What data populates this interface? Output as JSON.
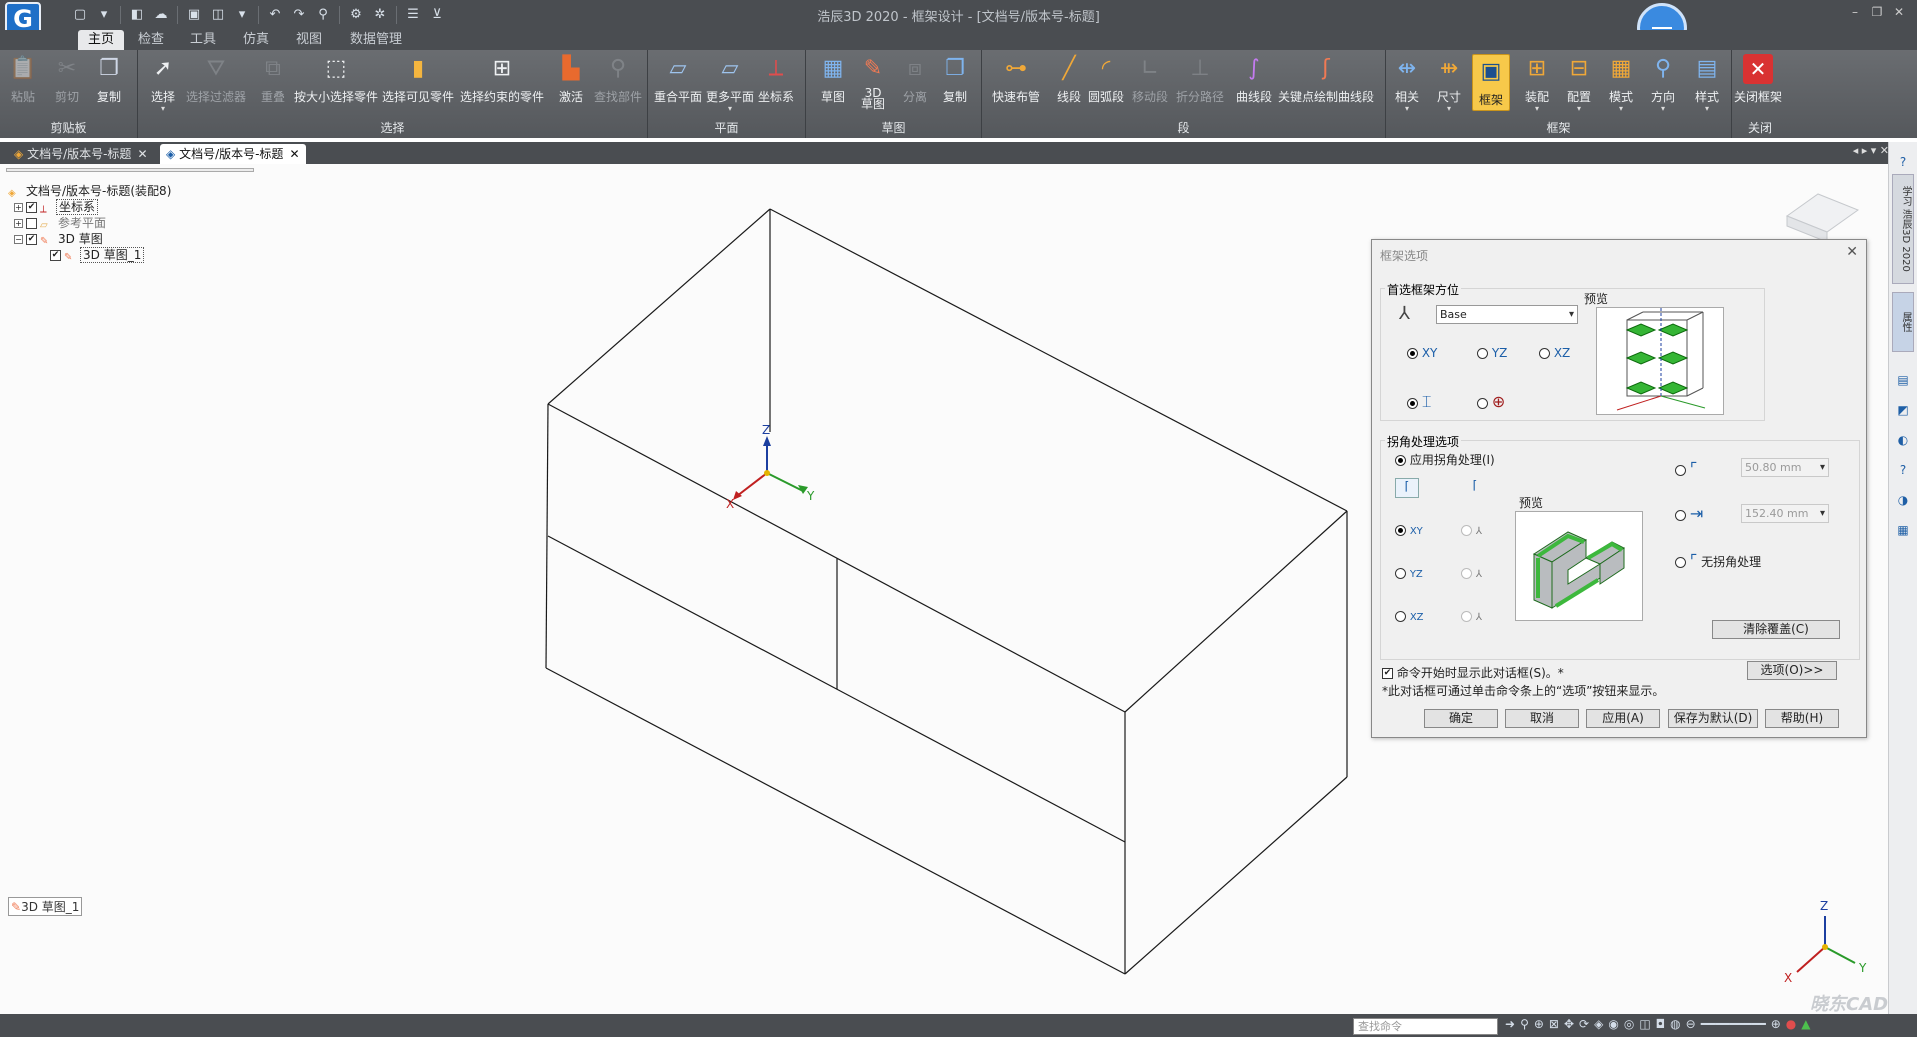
{
  "window": {
    "title": "浩辰3D 2020 - 框架设计 - [文档号/版本号-标题]"
  },
  "ribbon_tabs": [
    "主页",
    "检查",
    "工具",
    "仿真",
    "视图",
    "数据管理"
  ],
  "ribbon": {
    "clipboard": {
      "group": "剪贴板",
      "paste": "粘贴",
      "cut": "剪切",
      "copy": "复制"
    },
    "select": {
      "group": "选择",
      "select": "选择",
      "filter": "选择过滤器",
      "overlap": "重叠",
      "by_size": "按大小选择零件",
      "visible": "选择可见零件",
      "constrained": "选择约束的零件",
      "activate": "激活",
      "find": "查找部件"
    },
    "plane": {
      "group": "平面",
      "coincident": "重合平面",
      "more": "更多平面",
      "coord": "坐标系"
    },
    "sketch": {
      "group": "草图",
      "sketch": "草图",
      "sketch3d": "3D\n草图",
      "separate": "分离",
      "copy": "复制"
    },
    "segment": {
      "group": "段",
      "quick_pipe": "快速布管",
      "line": "线段",
      "arc": "圆弧段",
      "move": "移动段",
      "bend": "折分路径",
      "curve": "曲线段",
      "keypoint": "关键点绘制曲线段"
    },
    "frame": {
      "group": "框架",
      "related": "相关",
      "size": "尺寸",
      "frame": "框架",
      "assemble": "装配",
      "config": "配置",
      "mode": "模式",
      "direction": "方向",
      "style": "样式"
    },
    "close": {
      "group": "关闭",
      "close_frame": "关闭框架"
    }
  },
  "doc_tabs": [
    {
      "label": "文档号/版本号-标题"
    },
    {
      "label": "文档号/版本号-标题"
    }
  ],
  "tree": {
    "root": "文档号/版本号-标题(装配8)",
    "items": [
      {
        "label": "坐标系",
        "checked": "✔"
      },
      {
        "label": "参考平面",
        "checked": ""
      },
      {
        "label": "3D 草图",
        "checked": "✔"
      },
      {
        "label": "3D 草图_1",
        "checked": "✔"
      }
    ]
  },
  "sketch_tag": "3D 草图_1",
  "axes": {
    "x": "X",
    "y": "Y",
    "z": "Z"
  },
  "right_bar": {
    "tab1": "学习 浩辰3D 2020",
    "tab2": "属性"
  },
  "dialog": {
    "title": "框架选项",
    "orient": {
      "legend": "首选框架方位",
      "base_value": "Base",
      "xy": "XY",
      "yz": "YZ",
      "xz": "XZ",
      "preview": "预览"
    },
    "corner": {
      "legend": "拐角处理选项",
      "apply": "应用拐角处理(I)",
      "preview": "预览",
      "value1": "50.80 mm",
      "value2": "152.40 mm",
      "none": "无拐角处理",
      "clear": "清除覆盖(C)"
    },
    "show_on_start": "命令开始时显示此对话框(S)。*",
    "note": "*此对话框可通过单击命令条上的“选项”按钮来显示。",
    "options_btn": "选项(O)>>",
    "ok": "确定",
    "cancel": "取消",
    "apply": "应用(A)",
    "save_default": "保存为默认(D)",
    "help": "帮助(H)"
  },
  "status": {
    "command_placeholder": "查找命令"
  },
  "watermark": "晓东CAD"
}
